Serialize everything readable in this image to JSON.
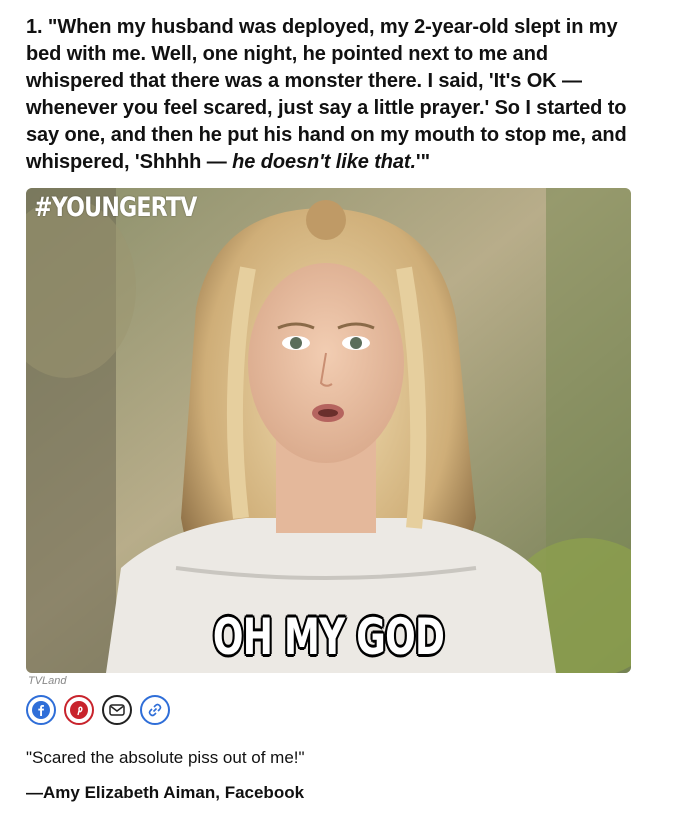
{
  "item": {
    "text_main": "1. \"When my husband was deployed, my 2-year-old slept in my bed with me. Well, one night, he pointed next to me and whispered that there was a monster there. I said, 'It's OK — whenever you feel scared, just say a little prayer.' So I started to say one, and then he put his hand on my mouth to stop me, and whispered, 'Shhhh — ",
    "text_italic": "he doesn't like that.",
    "text_end": "'\""
  },
  "media": {
    "hashtag": "#YOUNGERTV",
    "caption": "OH MY GOD",
    "credit": "TVLand"
  },
  "share": {
    "icons": [
      "facebook-icon",
      "pinterest-icon",
      "email-icon",
      "link-icon"
    ],
    "colors": {
      "facebook": "#2f6ed8",
      "pinterest": "#c8232c",
      "email": "#222222",
      "link": "#2f6ed8"
    }
  },
  "quote": "\"Scared the absolute piss out of me!\"",
  "attribution": "—Amy Elizabeth Aiman, Facebook"
}
